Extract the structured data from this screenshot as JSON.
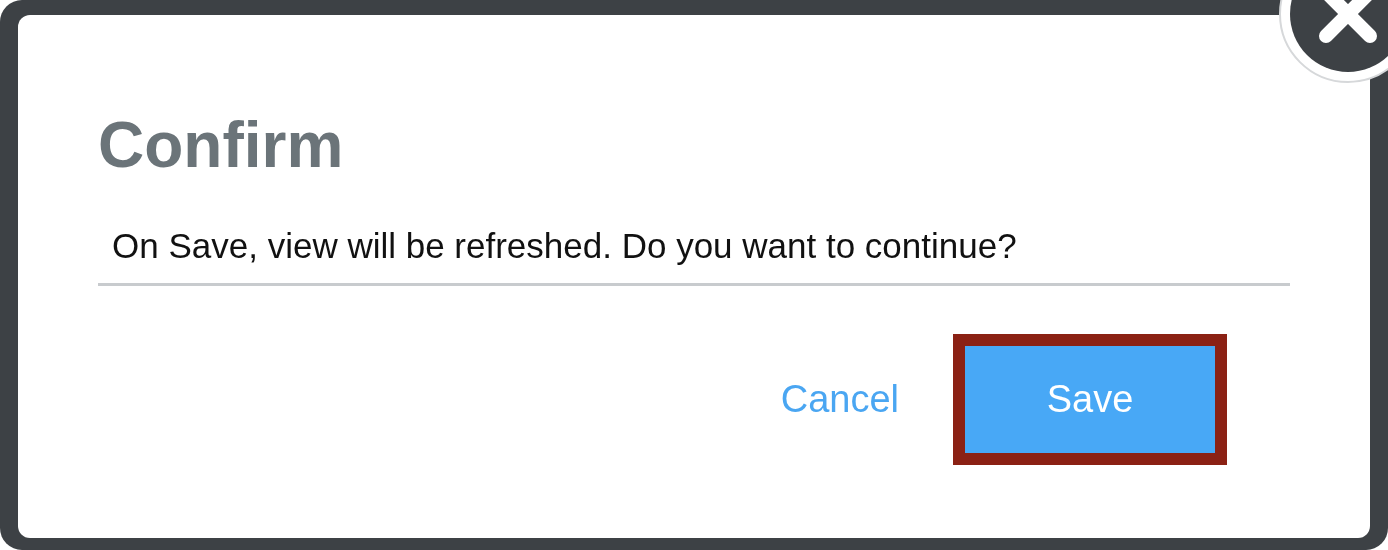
{
  "dialog": {
    "title": "Confirm",
    "message": "On Save, view will be refreshed. Do you want to continue?"
  },
  "buttons": [
    {
      "label": "Cancel",
      "kind": "link",
      "highlighted": false
    },
    {
      "label": "Save",
      "kind": "primary",
      "highlighted": true
    }
  ]
}
